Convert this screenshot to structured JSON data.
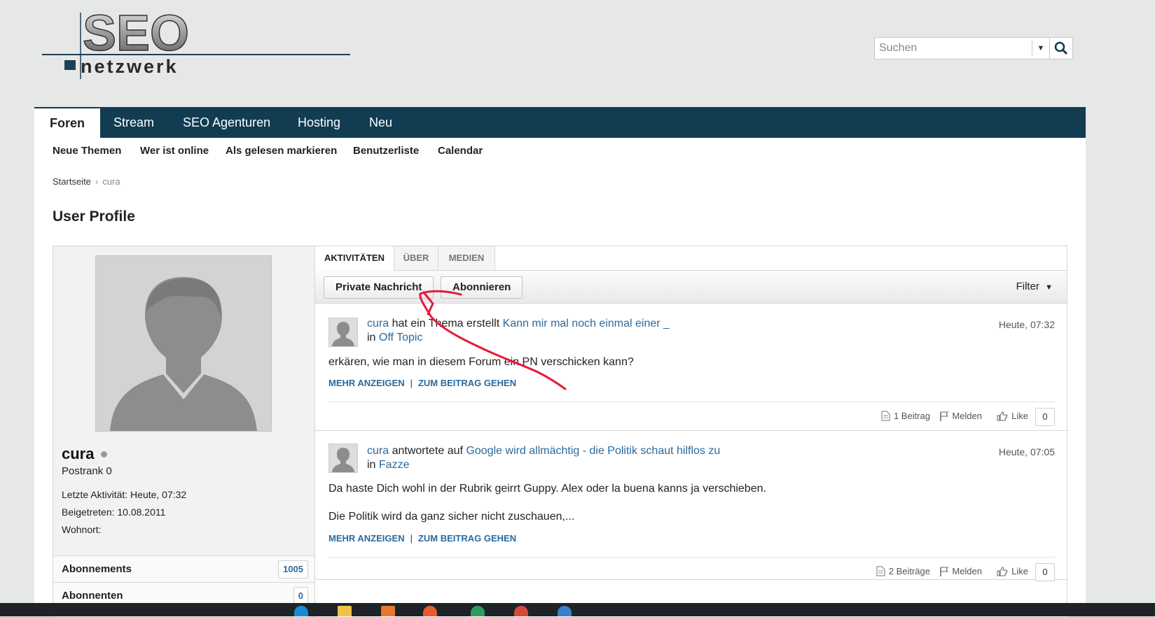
{
  "logo": {
    "text_top": "SEO",
    "text_bottom": "netzwerk"
  },
  "search": {
    "placeholder": "Suchen"
  },
  "nav": {
    "tabs": [
      "Foren",
      "Stream",
      "SEO Agenturen",
      "Hosting",
      "Neu"
    ],
    "active": "Foren",
    "subnav": [
      "Neue Themen",
      "Wer ist online",
      "Als gelesen markieren",
      "Benutzerliste",
      "Calendar"
    ]
  },
  "breadcrumb": {
    "home": "Startseite",
    "current": "cura"
  },
  "page_title": "User Profile",
  "profile": {
    "username": "cura",
    "rank": "Postrank 0",
    "last_activity": "Letzte Aktivität: Heute, 07:32",
    "joined": "Beigetreten: 10.08.2011",
    "location": "Wohnort:",
    "stats": [
      {
        "label": "Abonnements",
        "count": "1005"
      },
      {
        "label": "Abonnenten",
        "count": "0"
      }
    ]
  },
  "activity": {
    "tabs": [
      "AKTIVITÄTEN",
      "ÜBER",
      "MEDIEN"
    ],
    "buttons": {
      "pm": "Private Nachricht",
      "subscribe": "Abonnieren"
    },
    "filter": "Filter",
    "posts": [
      {
        "user": "cura",
        "action": "hat ein Thema erstellt",
        "thread": "Kann mir mal noch einmal einer _",
        "in_label": "in",
        "forum": "Off Topic",
        "time": "Heute, 07:32",
        "text": [
          "erkären, wie man in diesem Forum ein PN verschicken kann?"
        ],
        "more": "MEHR ANZEIGEN",
        "goto": "ZUM BEITRAG GEHEN",
        "pipe": "|",
        "replies": "1 Beitrag",
        "report": "Melden",
        "like": "Like",
        "like_count": "0"
      },
      {
        "user": "cura",
        "action": "antwortete auf",
        "thread": "Google wird allmächtig - die Politik schaut hilflos zu",
        "in_label": "in",
        "forum": "Fazze",
        "time": "Heute, 07:05",
        "text": [
          "Da haste Dich wohl in der Rubrik geirrt Guppy. Alex oder la buena kanns ja verschieben.",
          "Die Politik wird da ganz sicher nicht zuschauen,..."
        ],
        "more": "MEHR ANZEIGEN",
        "goto": "ZUM BEITRAG GEHEN",
        "pipe": "|",
        "replies": "2 Beiträge",
        "report": "Melden",
        "like": "Like",
        "like_count": "0"
      }
    ]
  },
  "colors": {
    "nav_bg": "#113c52",
    "link": "#2a6a9e",
    "annotation": "#e8193a"
  }
}
